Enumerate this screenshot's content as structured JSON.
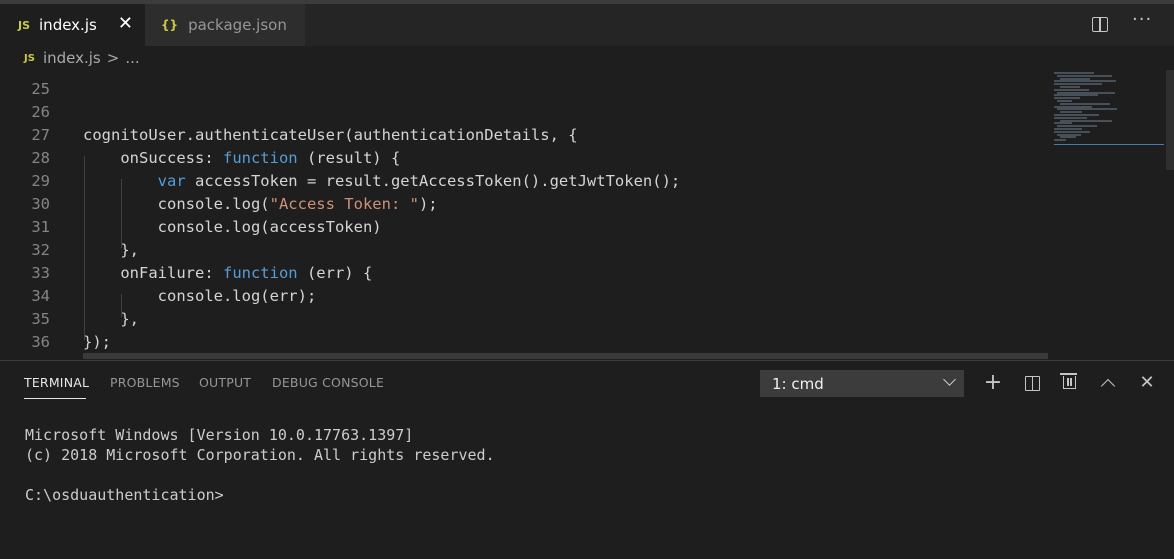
{
  "tabs": [
    {
      "icon_label": "JS",
      "label": "index.js",
      "active": true
    },
    {
      "icon_label": "{}",
      "label": "package.json",
      "active": false
    }
  ],
  "breadcrumb": {
    "icon_label": "JS",
    "file": "index.js",
    "separator": ">",
    "more": "..."
  },
  "editor": {
    "lines": [
      {
        "num": "25",
        "code": ""
      },
      {
        "num": "26",
        "code": ""
      },
      {
        "num": "27",
        "code": "cognitoUser.authenticateUser(authenticationDetails, {"
      },
      {
        "num": "28",
        "code": "    onSuccess: function (result) {"
      },
      {
        "num": "29",
        "code": "        var accessToken = result.getAccessToken().getJwtToken();"
      },
      {
        "num": "30",
        "code": "        console.log(\"Access Token: \");"
      },
      {
        "num": "31",
        "code": "        console.log(accessToken)"
      },
      {
        "num": "32",
        "code": "    },"
      },
      {
        "num": "33",
        "code": "    onFailure: function (err) {"
      },
      {
        "num": "34",
        "code": "        console.log(err);"
      },
      {
        "num": "35",
        "code": "    },"
      },
      {
        "num": "36",
        "code": "});"
      }
    ]
  },
  "panel": {
    "tabs": [
      "TERMINAL",
      "PROBLEMS",
      "OUTPUT",
      "DEBUG CONSOLE"
    ],
    "active_tab": "TERMINAL",
    "terminal_select": "1: cmd",
    "terminal_lines": [
      "Microsoft Windows [Version 10.0.17763.1397]",
      "(c) 2018 Microsoft Corporation. All rights reserved.",
      "",
      "C:\\osduauthentication>"
    ]
  },
  "icons": {
    "close": "close-icon",
    "split": "split-editor-icon",
    "more": "more-actions-icon",
    "add": "add-terminal-icon",
    "trash": "kill-terminal-icon",
    "maximize": "chevron-up-icon"
  },
  "colors": {
    "keyword": "#569cd6",
    "string": "#ce9178",
    "js_icon": "#cbcb41",
    "background": "#1e1e1e"
  }
}
